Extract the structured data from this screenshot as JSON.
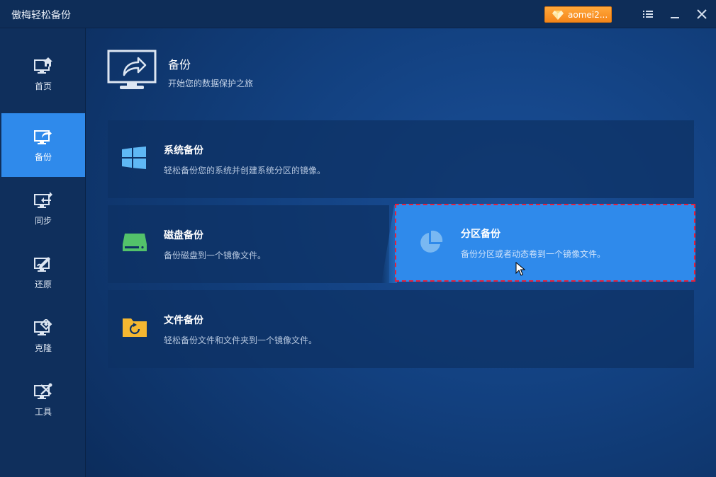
{
  "window": {
    "title": "傲梅轻松备份",
    "account_label": "aomei2...",
    "accent": "#2f8aeb",
    "account_color": "#f5861a"
  },
  "sidebar": {
    "items": [
      {
        "label": "首页",
        "icon": "home-monitor-icon",
        "active": false
      },
      {
        "label": "备份",
        "icon": "backup-monitor-icon",
        "active": true
      },
      {
        "label": "同步",
        "icon": "sync-monitor-icon",
        "active": false
      },
      {
        "label": "还原",
        "icon": "restore-monitor-icon",
        "active": false
      },
      {
        "label": "克隆",
        "icon": "clone-monitor-icon",
        "active": false
      },
      {
        "label": "工具",
        "icon": "tools-monitor-icon",
        "active": false
      }
    ]
  },
  "header": {
    "title": "备份",
    "subtitle": "开始您的数据保护之旅",
    "icon": "backup-monitor-icon"
  },
  "cards": {
    "system": {
      "title": "系统备份",
      "desc": "轻松备份您的系统并创建系统分区的镜像。",
      "icon": "windows-icon"
    },
    "disk": {
      "title": "磁盘备份",
      "desc": "备份磁盘到一个镜像文件。",
      "icon": "disk-icon"
    },
    "partition": {
      "title": "分区备份",
      "desc": "备份分区或者动态卷到一个镜像文件。",
      "icon": "partition-pie-icon",
      "highlight_color": "#e8203a"
    },
    "file": {
      "title": "文件备份",
      "desc": "轻松备份文件和文件夹到一个镜像文件。",
      "icon": "file-folder-icon"
    }
  }
}
